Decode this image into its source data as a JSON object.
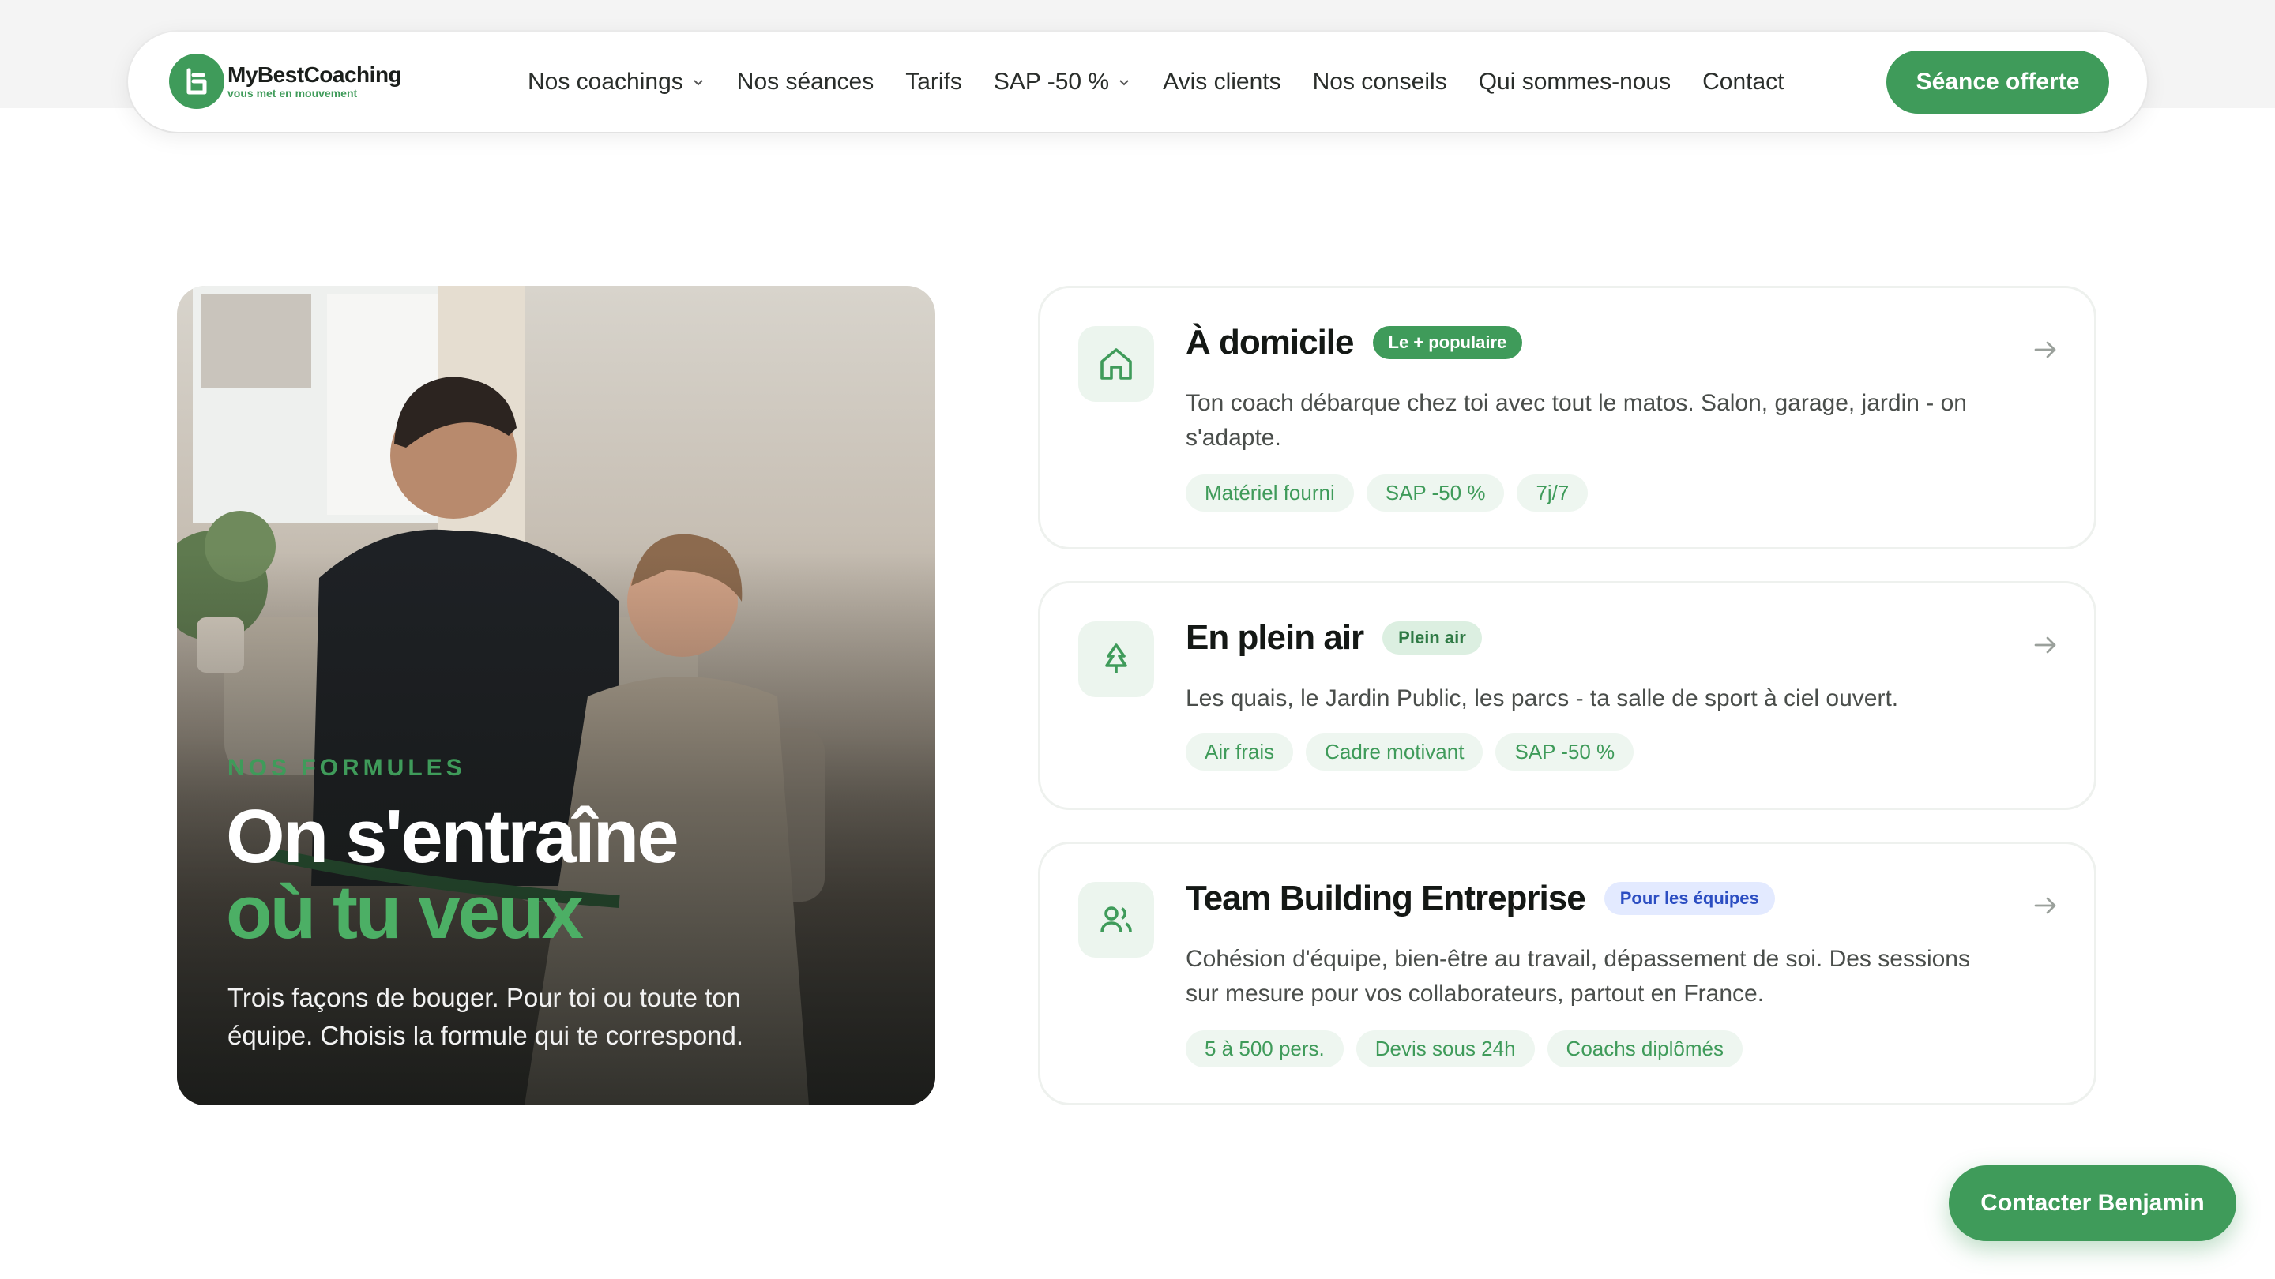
{
  "brand": {
    "name": "MyBestCoaching",
    "tagline": "vous met en mouvement",
    "accent": "#3f9b5a"
  },
  "nav": {
    "items": [
      {
        "label": "Nos coachings",
        "has_dropdown": true
      },
      {
        "label": "Nos séances",
        "has_dropdown": false
      },
      {
        "label": "Tarifs",
        "has_dropdown": false
      },
      {
        "label": "SAP -50 %",
        "has_dropdown": true
      },
      {
        "label": "Avis clients",
        "has_dropdown": false
      },
      {
        "label": "Nos conseils",
        "has_dropdown": false
      },
      {
        "label": "Qui sommes-nous",
        "has_dropdown": false
      },
      {
        "label": "Contact",
        "has_dropdown": false
      }
    ],
    "cta_label": "Séance offerte"
  },
  "hero": {
    "eyebrow": "NOS FORMULES",
    "title_line1": "On s'entraîne",
    "title_line2": "où tu veux",
    "subtitle": "Trois façons de bouger. Pour toi ou toute ton équipe. Choisis la formule qui te correspond."
  },
  "offers": [
    {
      "icon": "home-icon",
      "title": "À domicile",
      "badge": "Le + populaire",
      "badge_style": "solid",
      "description": "Ton coach débarque chez toi avec tout le matos. Salon, garage, jardin - on s'adapte.",
      "chips": [
        "Matériel fourni",
        "SAP -50 %",
        "7j/7"
      ]
    },
    {
      "icon": "tree-icon",
      "title": "En plein air",
      "badge": "Plein air",
      "badge_style": "soft",
      "description": "Les quais, le Jardin Public, les parcs - ta salle de sport à ciel ouvert.",
      "chips": [
        "Air frais",
        "Cadre motivant",
        "SAP -50 %"
      ]
    },
    {
      "icon": "users-icon",
      "title": "Team Building Entreprise",
      "badge": "Pour les équipes",
      "badge_style": "blue",
      "description": "Cohésion d'équipe, bien-être au travail, dépassement de soi. Des sessions sur mesure pour vos collaborateurs, partout en France.",
      "chips": [
        "5 à 500 pers.",
        "Devis sous 24h",
        "Coachs diplômés"
      ]
    }
  ],
  "floating_contact_label": "Contacter Benjamin"
}
